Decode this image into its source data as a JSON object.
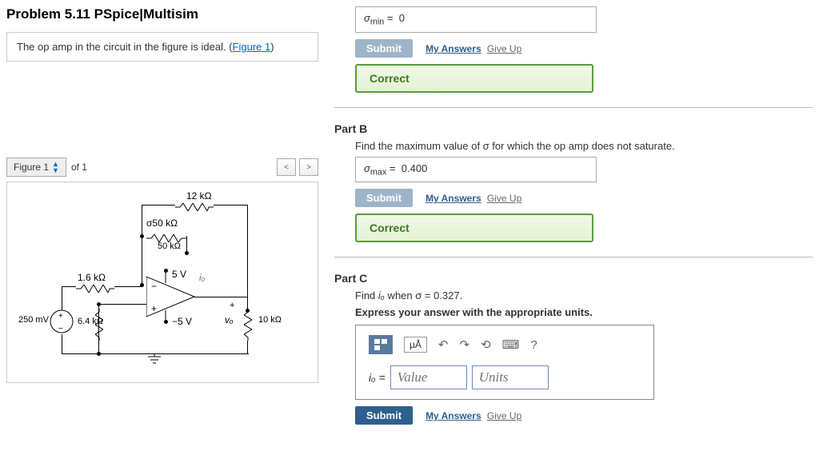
{
  "title": "Problem 5.11 PSpice|Multisim",
  "description": {
    "text": "The op amp in the circuit in the figure is ideal. (",
    "link": "Figure 1",
    "suffix": ")"
  },
  "figure_nav": {
    "label": "Figure 1",
    "counter": "of 1"
  },
  "circuit_labels": {
    "r12k": "12 kΩ",
    "sigma50k": "σ50 kΩ",
    "r50k": "50 kΩ",
    "r1_6k": "1.6 kΩ",
    "v5p": "5 V",
    "v5n": "−5 V",
    "io": "iₒ",
    "v250mv": "250 mV",
    "r6_4k": "6.4 kΩ",
    "vo": "vₒ",
    "r10k": "10 kΩ"
  },
  "partA": {
    "answer_label": "σ",
    "answer_subscript": "min",
    "answer_eq": " = ",
    "answer_value": "0",
    "submit": "Submit",
    "my_answers": "My Answers",
    "giveup": "Give Up",
    "correct": "Correct"
  },
  "partB": {
    "header": "Part B",
    "prompt": "Find the maximum value of σ for which the op amp does not saturate.",
    "answer_label": "σ",
    "answer_subscript": "max",
    "answer_eq": " = ",
    "answer_value": "0.400",
    "submit": "Submit",
    "my_answers": "My Answers",
    "giveup": "Give Up",
    "correct": "Correct"
  },
  "partC": {
    "header": "Part C",
    "prompt_prefix": "Find ",
    "prompt_var": "iₒ",
    "prompt_mid": " when σ = 0.327.",
    "instr": "Express your answer with the appropriate units.",
    "toolbar": {
      "units_btn": "µÅ",
      "help": "?"
    },
    "label": "iₒ = ",
    "value_ph": "Value",
    "units_ph": "Units",
    "submit": "Submit",
    "my_answers": "My Answers",
    "giveup": "Give Up"
  }
}
